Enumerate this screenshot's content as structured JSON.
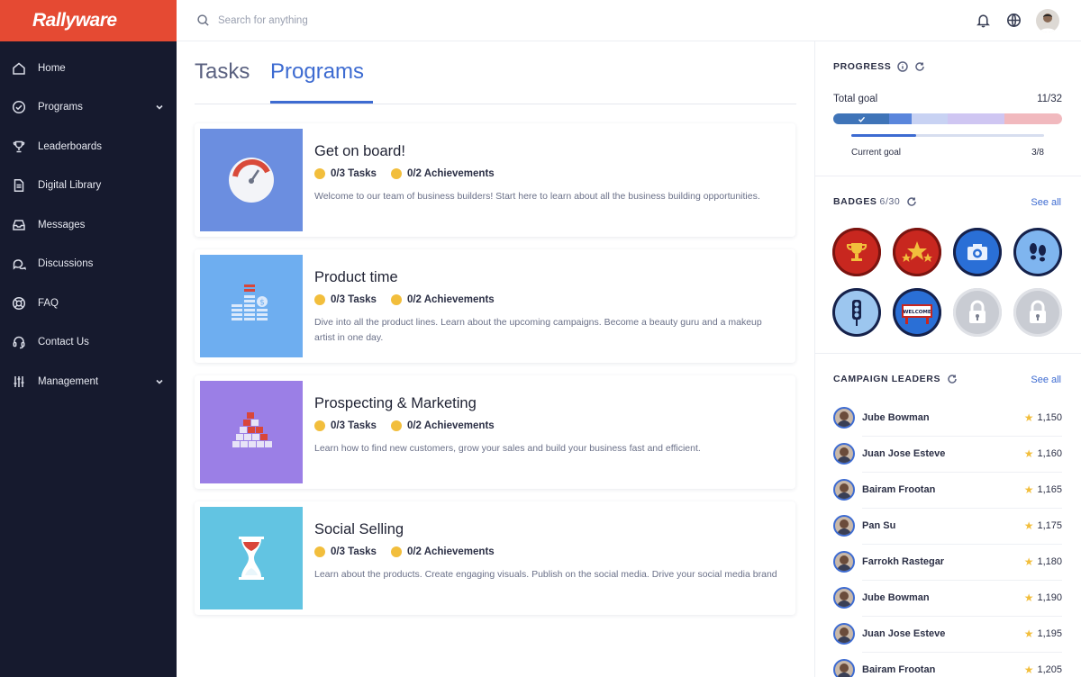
{
  "app": {
    "logo_text": "Rallyware",
    "brand_color": "#e54a33"
  },
  "sidebar": {
    "items": [
      {
        "label": "Home",
        "icon": "home-icon"
      },
      {
        "label": "Programs",
        "icon": "check-circle-icon",
        "expandable": true
      },
      {
        "label": "Leaderboards",
        "icon": "trophy-icon"
      },
      {
        "label": "Digital Library",
        "icon": "document-icon"
      },
      {
        "label": "Messages",
        "icon": "inbox-icon"
      },
      {
        "label": "Discussions",
        "icon": "chat-bubbles-icon"
      },
      {
        "label": "FAQ",
        "icon": "lifebuoy-icon"
      },
      {
        "label": "Contact Us",
        "icon": "headset-icon"
      },
      {
        "label": "Management",
        "icon": "sliders-icon",
        "expandable": true
      }
    ]
  },
  "topbar": {
    "search_placeholder": "Search for anything"
  },
  "main": {
    "tabs": [
      {
        "label": "Tasks"
      },
      {
        "label": "Programs",
        "active": true
      }
    ],
    "programs": [
      {
        "title": "Get on board!",
        "tasks": "0/3 Tasks",
        "achievements": "0/2 Achievements",
        "description": "Welcome to our team of business builders! Start here to learn about all the business building opportunities.",
        "thumb_color": "#6b8ee0",
        "icon": "gauge-icon"
      },
      {
        "title": "Product time",
        "tasks": "0/3 Tasks",
        "achievements": "0/2 Achievements",
        "description": "Dive into all the product lines. Learn about the upcoming campaigns. Become a beauty guru and a makeup artist in one day.",
        "thumb_color": "#6eaef0",
        "icon": "bar-stack-icon"
      },
      {
        "title": "Prospecting & Marketing",
        "tasks": "0/3 Tasks",
        "achievements": "0/2 Achievements",
        "description": "Learn how to find new customers, grow your sales and build your business fast and efficient.",
        "thumb_color": "#9b7fe6",
        "icon": "pyramid-icon"
      },
      {
        "title": "Social Selling",
        "tasks": "0/3 Tasks",
        "achievements": "0/2 Achievements",
        "description": "Learn about the products. Create engaging visuals. Publish on the social media. Drive your social media brand",
        "thumb_color": "#62c4e2",
        "icon": "hourglass-icon"
      }
    ]
  },
  "right": {
    "progress": {
      "title": "PROGRESS",
      "total_label": "Total goal",
      "total_value": "11/32",
      "total_fraction": 0.34,
      "current_label": "Current goal",
      "current_value": "3/8",
      "current_fraction": 0.375
    },
    "badges": {
      "title": "BADGES",
      "count": "6/30",
      "see_all": "See all",
      "items": [
        {
          "name": "trophy-badge-icon",
          "color": "#c8271f"
        },
        {
          "name": "stars-badge-icon",
          "color": "#c8271f"
        },
        {
          "name": "camera-badge-icon",
          "color": "#2a6fd6"
        },
        {
          "name": "footprints-badge-icon",
          "color": "#7fb5ef"
        },
        {
          "name": "traffic-light-badge-icon",
          "color": "#9cc6ef"
        },
        {
          "name": "welcome-badge-icon",
          "color": "#2a6fd6",
          "text": "WELCOME"
        },
        {
          "name": "locked-badge-icon",
          "color": "#c9ccd3"
        },
        {
          "name": "locked-badge-icon",
          "color": "#c9ccd3"
        }
      ]
    },
    "leaders": {
      "title": "CAMPAIGN LEADERS",
      "see_all": "See all",
      "rows": [
        {
          "name": "Jube Bowman",
          "score": "1,150"
        },
        {
          "name": "Juan Jose Esteve",
          "score": "1,160"
        },
        {
          "name": "Bairam Frootan",
          "score": "1,165"
        },
        {
          "name": "Pan Su",
          "score": "1,175"
        },
        {
          "name": "Farrokh Rastegar",
          "score": "1,180"
        },
        {
          "name": "Jube Bowman",
          "score": "1,190"
        },
        {
          "name": "Juan Jose Esteve",
          "score": "1,195"
        },
        {
          "name": "Bairam Frootan",
          "score": "1,205"
        }
      ]
    }
  }
}
